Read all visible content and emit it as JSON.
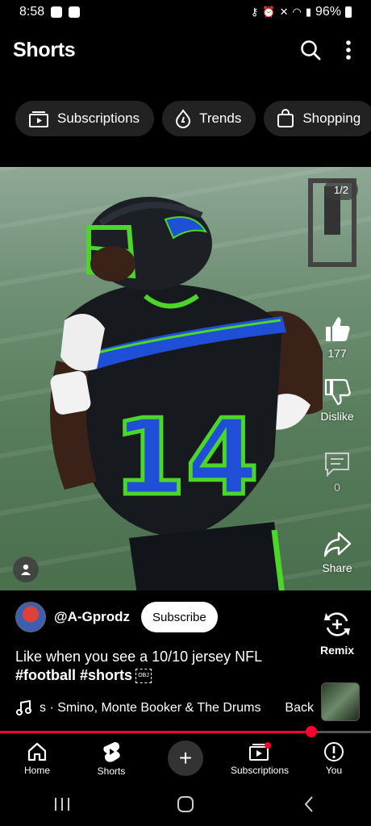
{
  "status_bar": {
    "time": "8:58",
    "battery": "96%"
  },
  "header": {
    "title": "Shorts",
    "search_icon": "search-icon",
    "more_icon": "more-vert-icon"
  },
  "chips": [
    {
      "label": "Subscriptions",
      "icon": "subscriptions-icon"
    },
    {
      "label": "Trends",
      "icon": "trends-icon"
    },
    {
      "label": "Shopping",
      "icon": "shopping-bag-icon"
    }
  ],
  "video": {
    "page_indicator": "1/2"
  },
  "actions": {
    "like_count": "177",
    "dislike_label": "Dislike",
    "comment_count": "0",
    "share_label": "Share",
    "remix_label": "Remix"
  },
  "channel": {
    "handle": "@A-Gprodz",
    "subscribe_label": "Subscribe"
  },
  "caption": {
    "text": "Like when you see a 10/10 jersey NFL",
    "hashtags": "#football #shorts"
  },
  "music": {
    "text": "s · Smino, Monte Booker & The Drums",
    "back_label": "Back"
  },
  "progress": {
    "fraction": 0.84
  },
  "bottom_nav": [
    {
      "label": "Home",
      "icon": "home-icon"
    },
    {
      "label": "Shorts",
      "icon": "shorts-icon"
    },
    {
      "label": "",
      "icon": "create-plus-icon"
    },
    {
      "label": "Subscriptions",
      "icon": "subscriptions-icon"
    },
    {
      "label": "You",
      "icon": "you-icon"
    }
  ],
  "colors": {
    "accent": "#ff0033",
    "chip_bg": "#222222",
    "jersey_green": "#4cd62a",
    "jersey_blue": "#1f4fd6"
  }
}
